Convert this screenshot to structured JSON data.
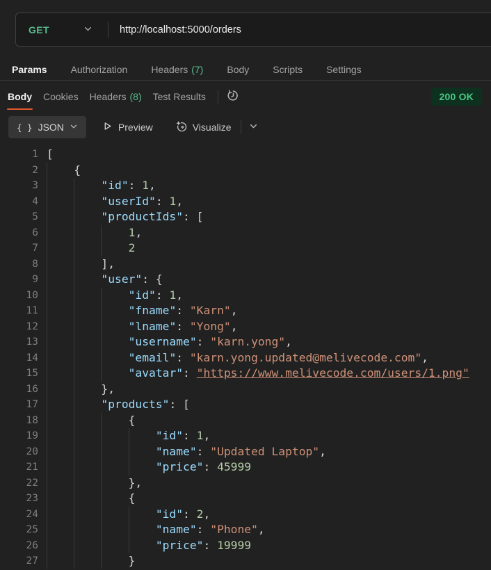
{
  "request": {
    "method": "GET",
    "url": "http://localhost:5000/orders",
    "tabs": [
      {
        "label": "Params",
        "active": true
      },
      {
        "label": "Authorization"
      },
      {
        "label": "Headers",
        "count": "(7)"
      },
      {
        "label": "Body"
      },
      {
        "label": "Scripts"
      },
      {
        "label": "Settings"
      }
    ]
  },
  "response": {
    "tabs": [
      {
        "label": "Body",
        "active": true
      },
      {
        "label": "Cookies"
      },
      {
        "label": "Headers",
        "count": "(8)"
      },
      {
        "label": "Test Results"
      }
    ],
    "status": "200 OK",
    "toolbar": {
      "format_icon": "{ }",
      "format_label": "JSON",
      "preview_label": "Preview",
      "visualize_label": "Visualize"
    }
  },
  "colors": {
    "green": "#56be8d",
    "orange": "#e25a2d",
    "badge_bg": "#0d301f",
    "badge_text": "#4ac885",
    "json_key": "#9cdcfe",
    "json_str": "#ce9178",
    "json_num": "#b5cea8"
  },
  "editor": {
    "lines": [
      {
        "num": 1,
        "indent": 0,
        "tokens": [
          [
            "p",
            "["
          ]
        ]
      },
      {
        "num": 2,
        "indent": 1,
        "tokens": [
          [
            "p",
            "{"
          ]
        ]
      },
      {
        "num": 3,
        "indent": 2,
        "tokens": [
          [
            "k",
            "\"id\""
          ],
          [
            "p",
            ": "
          ],
          [
            "n",
            "1"
          ],
          [
            "p",
            ","
          ]
        ]
      },
      {
        "num": 4,
        "indent": 2,
        "tokens": [
          [
            "k",
            "\"userId\""
          ],
          [
            "p",
            ": "
          ],
          [
            "n",
            "1"
          ],
          [
            "p",
            ","
          ]
        ]
      },
      {
        "num": 5,
        "indent": 2,
        "tokens": [
          [
            "k",
            "\"productIds\""
          ],
          [
            "p",
            ": ["
          ]
        ]
      },
      {
        "num": 6,
        "indent": 3,
        "tokens": [
          [
            "n",
            "1"
          ],
          [
            "p",
            ","
          ]
        ]
      },
      {
        "num": 7,
        "indent": 3,
        "tokens": [
          [
            "n",
            "2"
          ]
        ]
      },
      {
        "num": 8,
        "indent": 2,
        "tokens": [
          [
            "p",
            "],"
          ]
        ]
      },
      {
        "num": 9,
        "indent": 2,
        "tokens": [
          [
            "k",
            "\"user\""
          ],
          [
            "p",
            ": {"
          ]
        ]
      },
      {
        "num": 10,
        "indent": 3,
        "tokens": [
          [
            "k",
            "\"id\""
          ],
          [
            "p",
            ": "
          ],
          [
            "n",
            "1"
          ],
          [
            "p",
            ","
          ]
        ]
      },
      {
        "num": 11,
        "indent": 3,
        "tokens": [
          [
            "k",
            "\"fname\""
          ],
          [
            "p",
            ": "
          ],
          [
            "s",
            "\"Karn\""
          ],
          [
            "p",
            ","
          ]
        ]
      },
      {
        "num": 12,
        "indent": 3,
        "tokens": [
          [
            "k",
            "\"lname\""
          ],
          [
            "p",
            ": "
          ],
          [
            "s",
            "\"Yong\""
          ],
          [
            "p",
            ","
          ]
        ]
      },
      {
        "num": 13,
        "indent": 3,
        "tokens": [
          [
            "k",
            "\"username\""
          ],
          [
            "p",
            ": "
          ],
          [
            "s",
            "\"karn.yong\""
          ],
          [
            "p",
            ","
          ]
        ]
      },
      {
        "num": 14,
        "indent": 3,
        "tokens": [
          [
            "k",
            "\"email\""
          ],
          [
            "p",
            ": "
          ],
          [
            "s",
            "\"karn.yong.updated@melivecode.com\""
          ],
          [
            "p",
            ","
          ]
        ]
      },
      {
        "num": 15,
        "indent": 3,
        "tokens": [
          [
            "k",
            "\"avatar\""
          ],
          [
            "p",
            ": "
          ],
          [
            "u",
            "\"https://www.melivecode.com/users/1.png\""
          ]
        ]
      },
      {
        "num": 16,
        "indent": 2,
        "tokens": [
          [
            "p",
            "},"
          ]
        ]
      },
      {
        "num": 17,
        "indent": 2,
        "tokens": [
          [
            "k",
            "\"products\""
          ],
          [
            "p",
            ": ["
          ]
        ]
      },
      {
        "num": 18,
        "indent": 3,
        "tokens": [
          [
            "p",
            "{"
          ]
        ]
      },
      {
        "num": 19,
        "indent": 4,
        "tokens": [
          [
            "k",
            "\"id\""
          ],
          [
            "p",
            ": "
          ],
          [
            "n",
            "1"
          ],
          [
            "p",
            ","
          ]
        ]
      },
      {
        "num": 20,
        "indent": 4,
        "tokens": [
          [
            "k",
            "\"name\""
          ],
          [
            "p",
            ": "
          ],
          [
            "s",
            "\"Updated Laptop\""
          ],
          [
            "p",
            ","
          ]
        ]
      },
      {
        "num": 21,
        "indent": 4,
        "tokens": [
          [
            "k",
            "\"price\""
          ],
          [
            "p",
            ": "
          ],
          [
            "n",
            "45999"
          ]
        ]
      },
      {
        "num": 22,
        "indent": 3,
        "tokens": [
          [
            "p",
            "},"
          ]
        ]
      },
      {
        "num": 23,
        "indent": 3,
        "tokens": [
          [
            "p",
            "{"
          ]
        ]
      },
      {
        "num": 24,
        "indent": 4,
        "tokens": [
          [
            "k",
            "\"id\""
          ],
          [
            "p",
            ": "
          ],
          [
            "n",
            "2"
          ],
          [
            "p",
            ","
          ]
        ]
      },
      {
        "num": 25,
        "indent": 4,
        "tokens": [
          [
            "k",
            "\"name\""
          ],
          [
            "p",
            ": "
          ],
          [
            "s",
            "\"Phone\""
          ],
          [
            "p",
            ","
          ]
        ]
      },
      {
        "num": 26,
        "indent": 4,
        "tokens": [
          [
            "k",
            "\"price\""
          ],
          [
            "p",
            ": "
          ],
          [
            "n",
            "19999"
          ]
        ]
      },
      {
        "num": 27,
        "indent": 3,
        "tokens": [
          [
            "p",
            "}"
          ]
        ]
      }
    ]
  }
}
